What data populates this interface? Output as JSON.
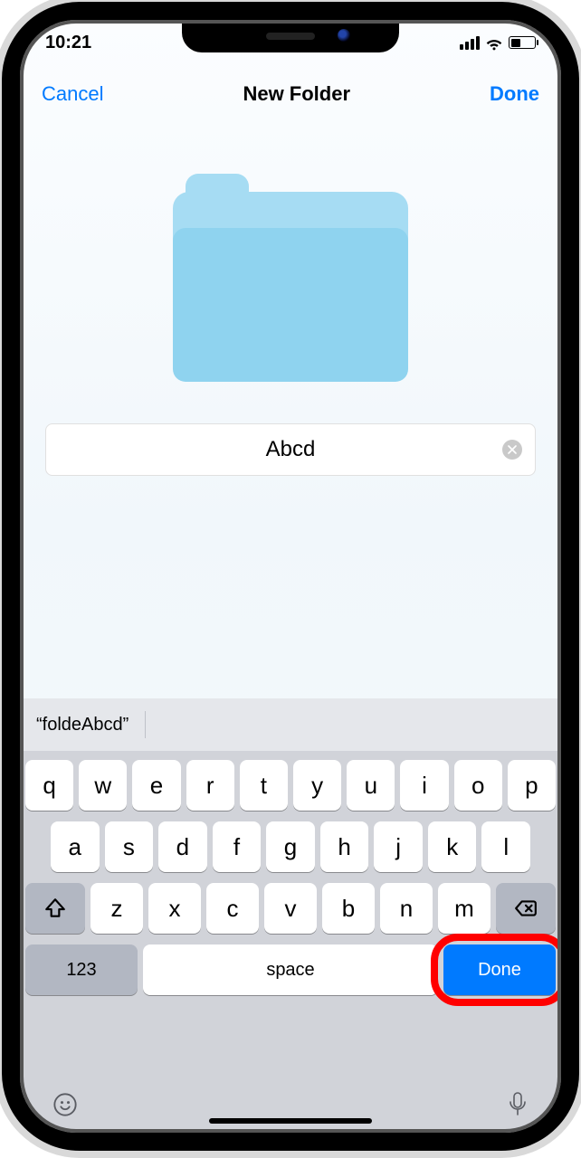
{
  "status": {
    "time": "10:21"
  },
  "nav": {
    "cancel": "Cancel",
    "title": "New Folder",
    "done": "Done"
  },
  "folder_name_input": {
    "value": "Abcd"
  },
  "keyboard": {
    "suggestion": "“foldeAbcd”",
    "row1": [
      "q",
      "w",
      "e",
      "r",
      "t",
      "y",
      "u",
      "i",
      "o",
      "p"
    ],
    "row2": [
      "a",
      "s",
      "d",
      "f",
      "g",
      "h",
      "j",
      "k",
      "l"
    ],
    "row3": [
      "z",
      "x",
      "c",
      "v",
      "b",
      "n",
      "m"
    ],
    "numeric_label": "123",
    "space_label": "space",
    "action_label": "Done"
  }
}
